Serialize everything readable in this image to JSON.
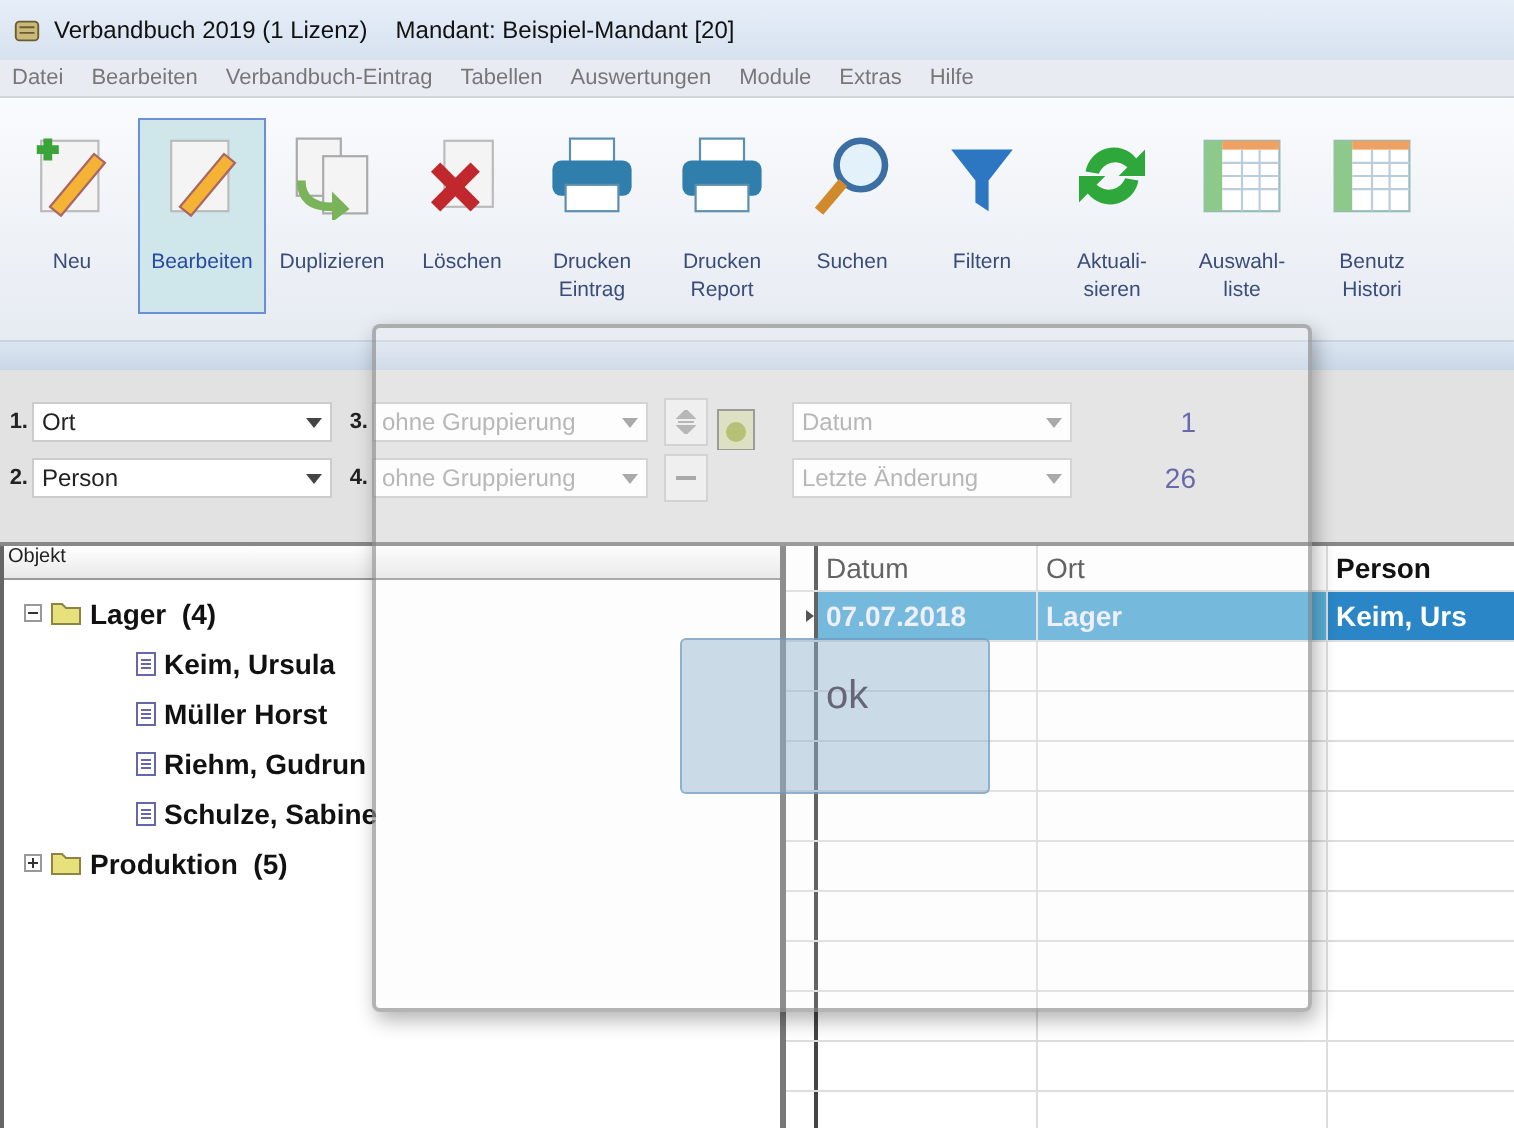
{
  "window": {
    "title": "Verbandbuch 2019  (1 Lizenz)",
    "client": "Mandant: Beispiel-Mandant [20]"
  },
  "menu": [
    "Datei",
    "Bearbeiten",
    "Verbandbuch-Eintrag",
    "Tabellen",
    "Auswertungen",
    "Module",
    "Extras",
    "Hilfe"
  ],
  "toolbar": [
    {
      "label": "Neu",
      "kind": "new",
      "selected": false
    },
    {
      "label": "Bearbeiten",
      "kind": "edit",
      "selected": true
    },
    {
      "label": "Duplizieren",
      "kind": "copy",
      "selected": false
    },
    {
      "label": "Löschen",
      "kind": "delete",
      "selected": false
    },
    {
      "label": "Drucken\nEintrag",
      "kind": "print",
      "selected": false
    },
    {
      "label": "Drucken\nReport",
      "kind": "print",
      "selected": false
    },
    {
      "label": "Suchen",
      "kind": "search",
      "selected": false
    },
    {
      "label": "Filtern",
      "kind": "filter",
      "selected": false
    },
    {
      "label": "Aktuali-\nsieren",
      "kind": "refresh",
      "selected": false
    },
    {
      "label": "Auswahl-\nliste",
      "kind": "table",
      "selected": false
    },
    {
      "label": "Benutz\nHistori",
      "kind": "table",
      "selected": false
    }
  ],
  "grouping": [
    {
      "number": "1.",
      "value": "Ort",
      "disabled": false
    },
    {
      "number": "2.",
      "value": "Person",
      "disabled": false
    },
    {
      "number": "3.",
      "value": "ohne Gruppierung",
      "disabled": true
    },
    {
      "number": "4.",
      "value": "ohne Gruppierung",
      "disabled": true
    }
  ],
  "sort_fields": [
    {
      "value": "Datum",
      "count": "1"
    },
    {
      "value": "Letzte Änderung",
      "count": "26"
    }
  ],
  "tree": {
    "header": "Objekt",
    "items": [
      {
        "label": "Lager",
        "count": "(4)",
        "expanded": true,
        "children": [
          {
            "label": "Keim, Ursula"
          },
          {
            "label": "Müller Horst"
          },
          {
            "label": "Riehm, Gudrun"
          },
          {
            "label": "Schulze, Sabine"
          }
        ]
      },
      {
        "label": "Produktion",
        "count": "(5)",
        "expanded": false
      }
    ]
  },
  "table": {
    "columns": [
      "Datum",
      "Ort",
      "Person"
    ],
    "rows": [
      {
        "cells": [
          "07.07.2018",
          "Lager",
          "Keim, Urs"
        ],
        "selected": true
      }
    ]
  },
  "overlay": {
    "button": "ok"
  }
}
